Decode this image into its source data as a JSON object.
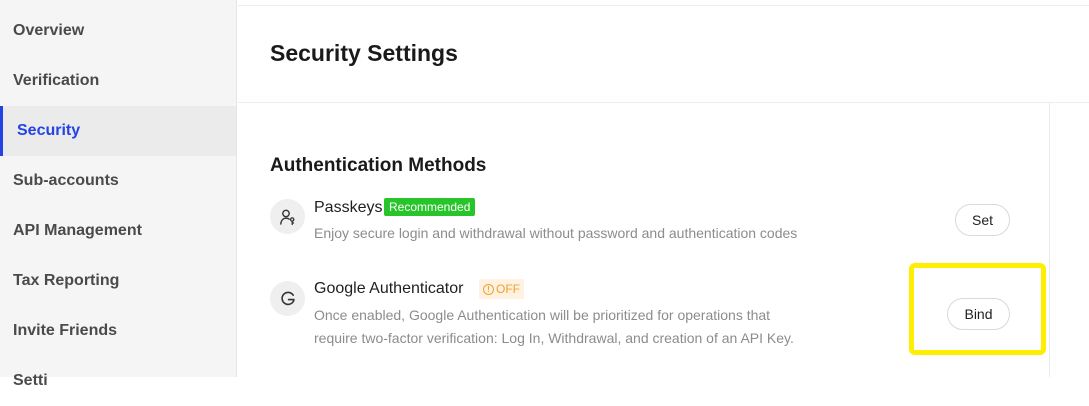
{
  "sidebar": {
    "items": [
      {
        "label": "Overview"
      },
      {
        "label": "Verification"
      },
      {
        "label": "Security"
      },
      {
        "label": "Sub-accounts"
      },
      {
        "label": "API Management"
      },
      {
        "label": "Tax Reporting"
      },
      {
        "label": "Invite Friends"
      },
      {
        "label": "Setti"
      }
    ],
    "active": "Security"
  },
  "header": {
    "title": "Security Settings"
  },
  "auth": {
    "section_title": "Authentication Methods",
    "methods": [
      {
        "icon": "user-key-icon",
        "name": "Passkeys",
        "badge": "Recommended",
        "description": "Enjoy secure login and withdrawal without password and authentication codes",
        "action": "Set"
      },
      {
        "icon": "google-g-icon",
        "name": "Google Authenticator",
        "badge": "OFF",
        "description_line1": "Once enabled, Google Authentication will be prioritized for operations that",
        "description_line2": "require two-factor verification: Log In, Withdrawal, and creation of an API Key.",
        "action": "Bind"
      }
    ]
  },
  "colors": {
    "accent": "#2343e4",
    "recommended": "#28c52a",
    "off": "#f0a030",
    "highlight": "#ffee00"
  }
}
